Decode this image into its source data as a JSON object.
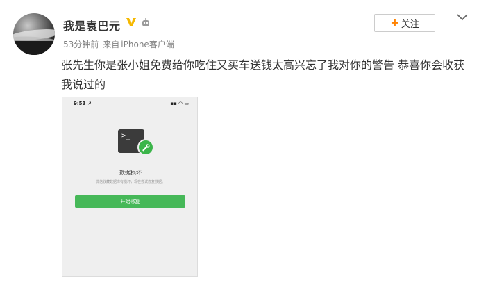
{
  "user": {
    "name": "我是袁巴元",
    "badge": "V",
    "verified_color": "#f5b800"
  },
  "meta": {
    "time": "53分钟前",
    "source_prefix": "来自",
    "source": "iPhone客户端"
  },
  "follow": {
    "plus": "+",
    "label": "关注",
    "accent": "#ff8200"
  },
  "menu": {
    "icon": "chevron-down-icon"
  },
  "post": {
    "text": "张先生你是张小姐免费给你吃住又买车送钱太高兴忘了我对你的警告 恭喜你会收获我说过的"
  },
  "screenshot": {
    "status_time": "9:53 ↗",
    "status_icons": "▪▪ ◠ ▭",
    "terminal_prompt": ">_",
    "title": "数据损坏",
    "description": "微信收藏数据库有损坏，现在尝试修复数据。",
    "button": "开始修复",
    "button_color": "#46b858"
  }
}
